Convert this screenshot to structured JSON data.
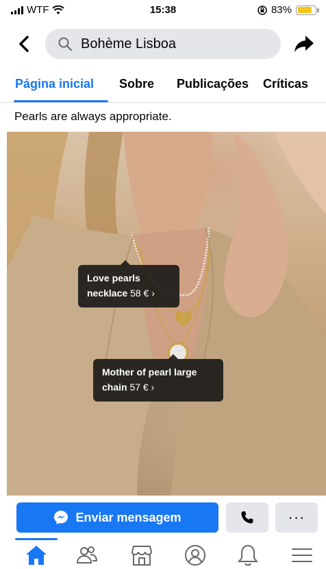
{
  "status_bar": {
    "carrier": "WTF",
    "time": "15:38",
    "battery_percent": "83%",
    "battery_level": 0.83,
    "battery_color": "#f5c518"
  },
  "header": {
    "back_icon": "chevron-left-icon",
    "search_icon": "search-icon",
    "search_value": "Bohème Lisboa",
    "share_icon": "share-arrow-icon"
  },
  "tabs": [
    {
      "label": "Página inicial",
      "active": true
    },
    {
      "label": "Sobre",
      "active": false
    },
    {
      "label": "Publicações",
      "active": false
    },
    {
      "label": "Críticas",
      "active": false
    }
  ],
  "post": {
    "caption": "Pearls are always appropriate.",
    "product_tags": [
      {
        "name_line1": "Love pearls",
        "name_line2": "necklace",
        "price": "58 € ›"
      },
      {
        "name_line1": "Mother of pearl large",
        "name_line2": "chain",
        "price": "57 € ›"
      }
    ]
  },
  "actions": {
    "message_label": "Enviar mensagem",
    "message_icon": "messenger-icon",
    "call_icon": "phone-icon",
    "more_label": "···"
  },
  "bottom_nav": {
    "items": [
      "home-icon",
      "friends-icon",
      "marketplace-icon",
      "profile-icon",
      "notifications-icon",
      "menu-icon"
    ],
    "active": "home-icon"
  },
  "colors": {
    "accent": "#1877f2",
    "button_gray": "#e4e6eb"
  }
}
